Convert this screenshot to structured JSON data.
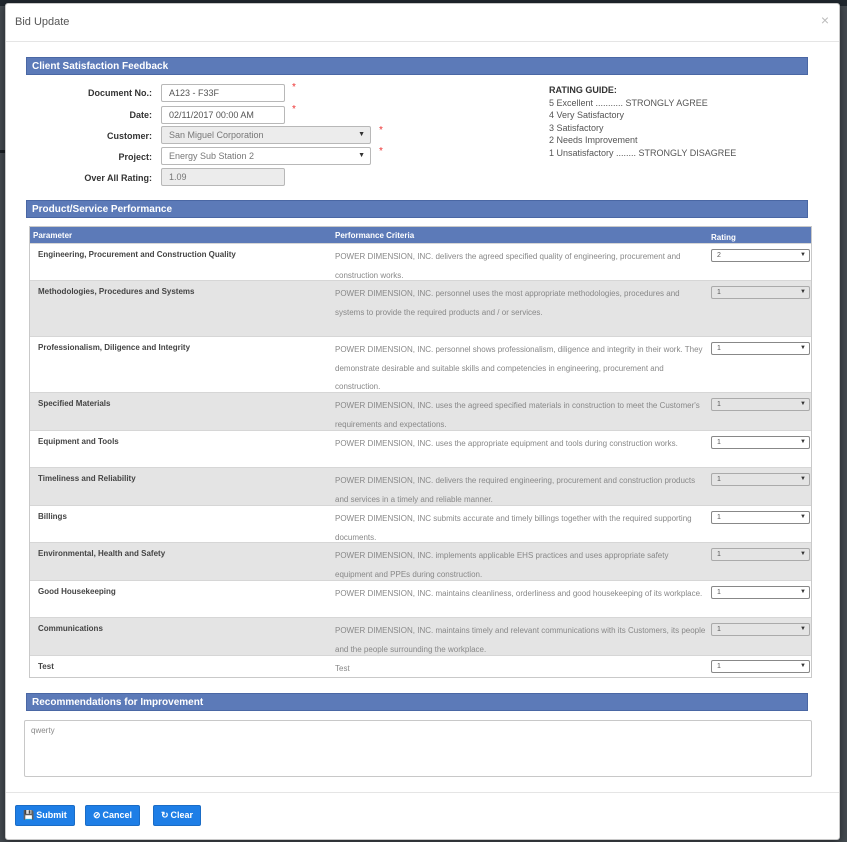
{
  "modal": {
    "title": "Bid Update",
    "close_icon": "×"
  },
  "sections": {
    "client_feedback": "Client Satisfaction Feedback",
    "performance": "Product/Service Performance",
    "recommendations": "Recommendations for Improvement"
  },
  "form": {
    "document_no": {
      "label": "Document No.:",
      "value": "A123 - F33F"
    },
    "date": {
      "label": "Date:",
      "value": "02/11/2017 00:00 AM"
    },
    "customer": {
      "label": "Customer:",
      "value": "San Miguel Corporation"
    },
    "project": {
      "label": "Project:",
      "value": "Energy Sub Station 2"
    },
    "overall_rating": {
      "label": "Over All Rating:",
      "value": "1.09"
    },
    "required_mark": "*"
  },
  "rating_guide": {
    "title": "RATING GUIDE:",
    "lines": [
      "5 Excellent ........... STRONGLY AGREE",
      "4 Very Satisfactory",
      "3 Satisfactory",
      "2 Needs Improvement",
      "1 Unsatisfactory ........ STRONGLY DISAGREE"
    ]
  },
  "table": {
    "headers": {
      "parameter": "Parameter",
      "criteria": "Performance Criteria",
      "rating": "Rating"
    },
    "rows": [
      {
        "parameter": "Engineering, Procurement and Construction Quality",
        "criteria": "POWER DIMENSION, INC. delivers the agreed specified quality of engineering, procurement and construction works.",
        "rating": "2"
      },
      {
        "parameter": "Methodologies, Procedures and Systems",
        "criteria": "POWER DIMENSION, INC. personnel uses the most appropriate methodologies, procedures and systems to provide the required products and / or services.",
        "rating": "1"
      },
      {
        "parameter": "Professionalism, Diligence and Integrity",
        "criteria": "POWER DIMENSION, INC. personnel shows professionalism, diligence and integrity in their work. They demonstrate desirable and suitable skills and competencies in engineering, procurement and construction.",
        "rating": "1"
      },
      {
        "parameter": "Specified Materials",
        "criteria": "POWER DIMENSION, INC. uses the agreed specified materials in construction to meet the Customer's requirements and expectations.",
        "rating": "1"
      },
      {
        "parameter": "Equipment and Tools",
        "criteria": "POWER DIMENSION, INC. uses the appropriate equipment and tools during construction works.",
        "rating": "1"
      },
      {
        "parameter": "Timeliness and Reliability",
        "criteria": "POWER DIMENSION, INC. delivers the required engineering, procurement and construction products and services in a timely and reliable manner.",
        "rating": "1"
      },
      {
        "parameter": "Billings",
        "criteria": "POWER DIMENSION, INC submits accurate and timely billings together with the required supporting documents.",
        "rating": "1"
      },
      {
        "parameter": "Environmental, Health and Safety",
        "criteria": "POWER DIMENSION, INC. implements applicable EHS practices and uses appropriate safety equipment and PPEs during construction.",
        "rating": "1"
      },
      {
        "parameter": "Good Housekeeping",
        "criteria": "POWER DIMENSION, INC. maintains cleanliness, orderliness and good housekeeping of its workplace.",
        "rating": "1"
      },
      {
        "parameter": "Communications",
        "criteria": "POWER DIMENSION, INC. maintains timely and relevant communications with its Customers, its people and the people surrounding the workplace.",
        "rating": "1"
      },
      {
        "parameter": "Test",
        "criteria": "Test",
        "rating": "1"
      }
    ]
  },
  "recommendations_text": "qwerty",
  "buttons": {
    "submit": "Submit",
    "cancel": "Cancel",
    "clear": "Clear"
  },
  "icons": {
    "submit": "save-icon",
    "cancel": "ban-icon",
    "clear": "refresh-icon"
  },
  "colors": {
    "section_bar": "#5c7ab8",
    "button": "#1e7ee6",
    "required": "#ee3333"
  }
}
